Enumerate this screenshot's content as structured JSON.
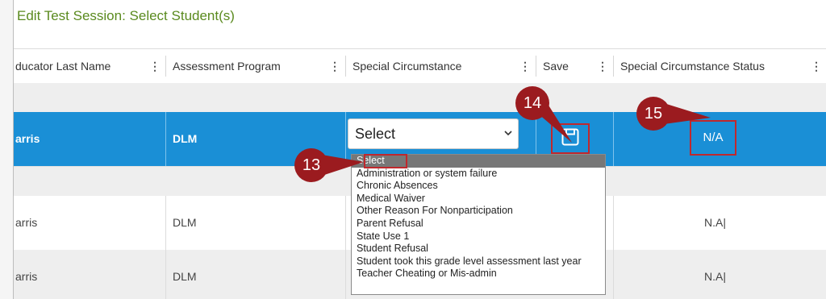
{
  "page": {
    "title": "Edit Test Session: Select Student(s)"
  },
  "columns": [
    {
      "label": "Educator Last Name",
      "shown": "ducator Last Name"
    },
    {
      "label": "Assessment Program"
    },
    {
      "label": "Special Circumstance"
    },
    {
      "label": "Save"
    },
    {
      "label": "Special Circumstance Status"
    }
  ],
  "column_menu_glyph": "⋮",
  "rows": [
    {
      "educator": "arris",
      "program": "DLM",
      "circumstance": "Select",
      "status": "N/A"
    },
    {
      "educator": "arris",
      "program": "DLM",
      "status": "N.A|"
    },
    {
      "educator": "arris",
      "program": "DLM",
      "status": "N.A|"
    }
  ],
  "dropdown": {
    "options": [
      "Select",
      "Administration or system failure",
      "Chronic Absences",
      "Medical Waiver",
      "Other Reason For Nonparticipation",
      "Parent Refusal",
      "State Use 1",
      "Student Refusal",
      "Student took this grade level assessment last year",
      "Teacher Cheating or Mis-admin"
    ],
    "highlighted": "Select"
  },
  "callouts": [
    {
      "number": "13"
    },
    {
      "number": "14"
    },
    {
      "number": "15"
    }
  ],
  "colors": {
    "selected_row": "#1a8fd6",
    "callout": "#9b1b1f",
    "highlight_border": "#c0282d",
    "title": "#5a8a1e"
  },
  "icons": {
    "save": "floppy-disk-icon",
    "select_caret": "chevron-down-icon",
    "column_menu": "kebab-menu-icon"
  }
}
